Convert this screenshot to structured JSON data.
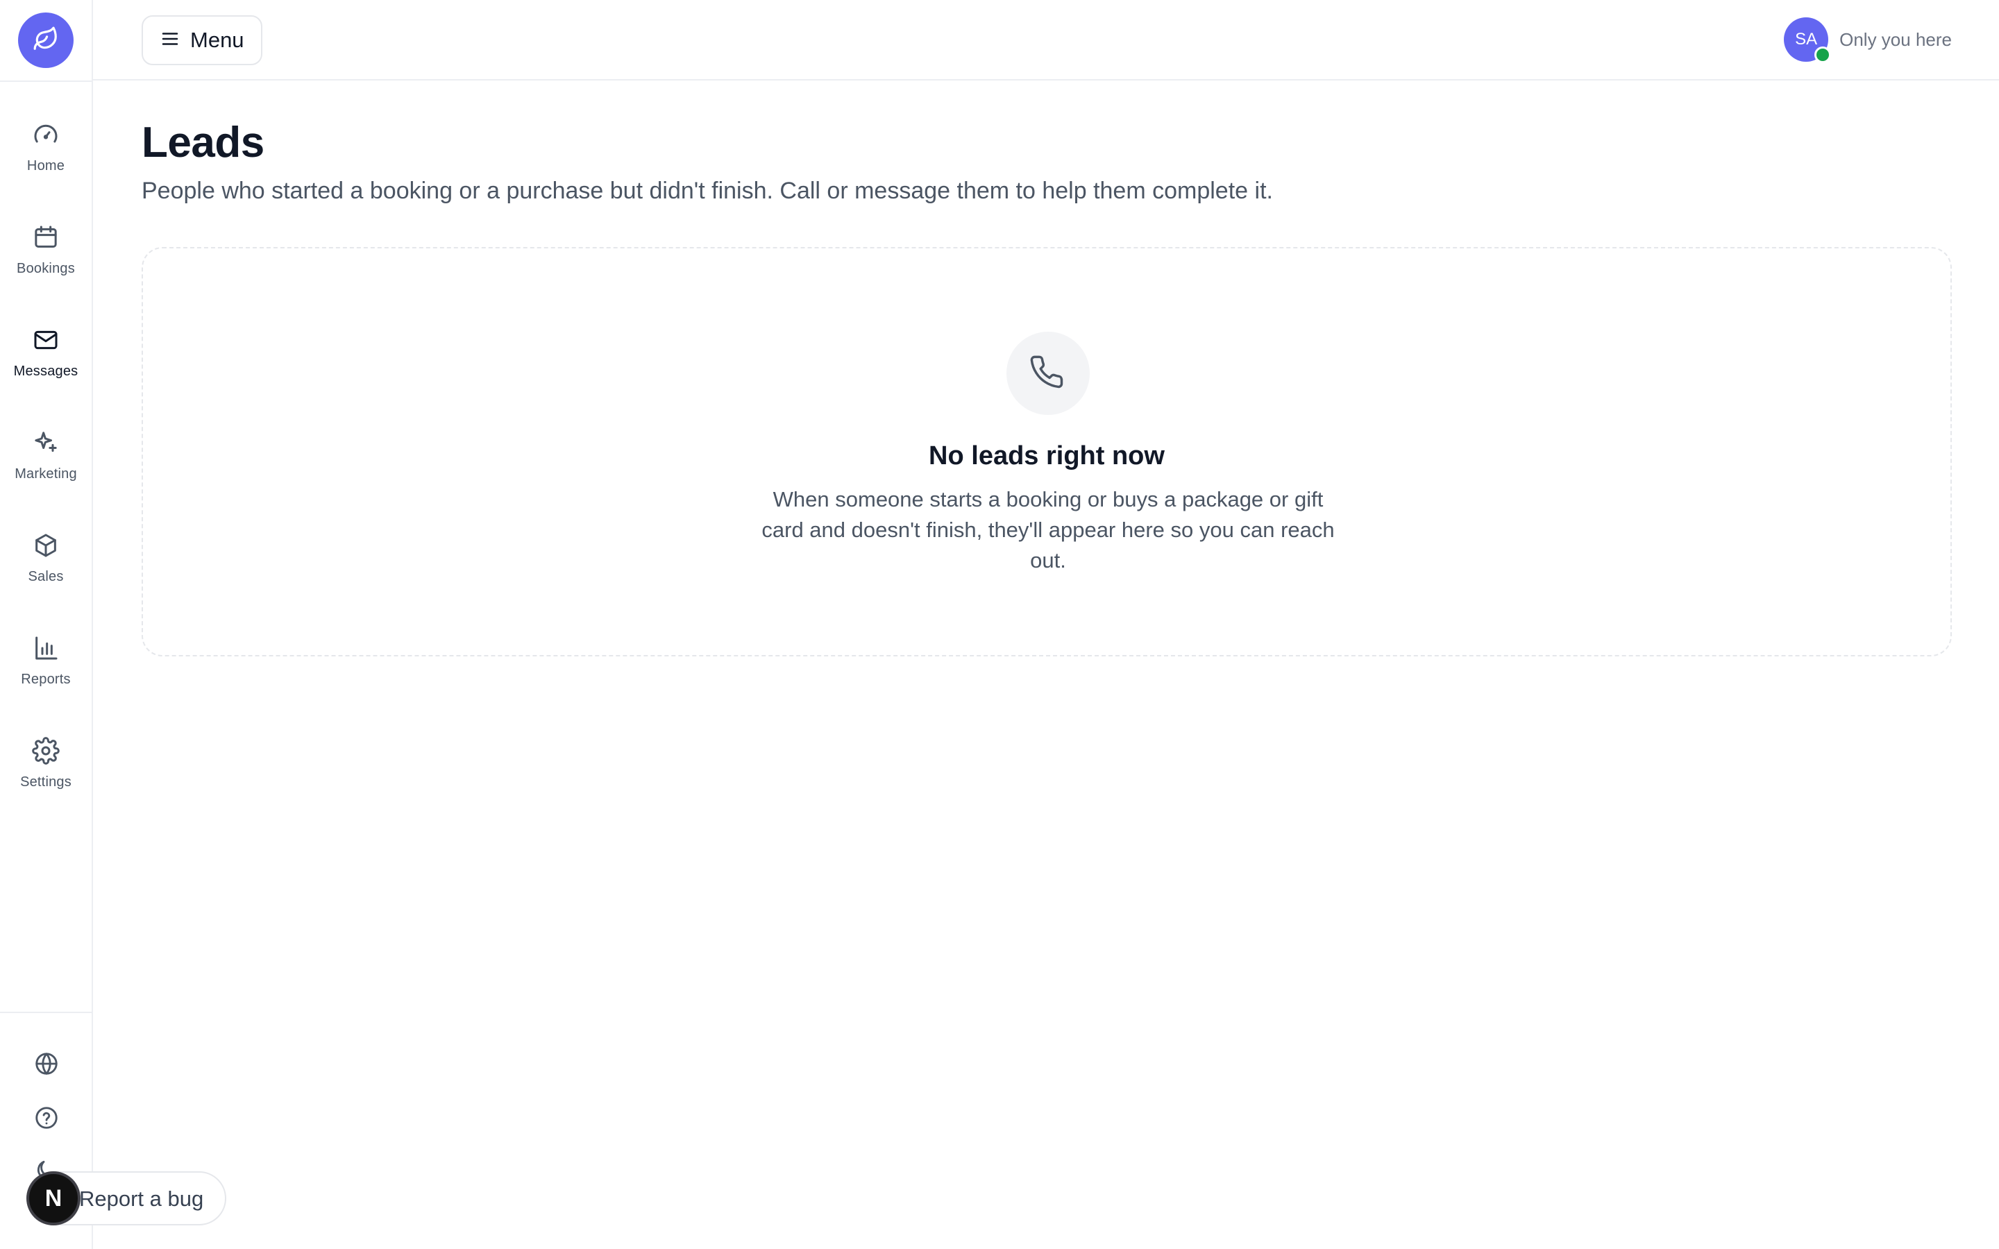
{
  "sidebar": {
    "logo_icon": "leaf-icon",
    "items": [
      {
        "label": "Home",
        "icon": "gauge-icon"
      },
      {
        "label": "Bookings",
        "icon": "calendar-icon"
      },
      {
        "label": "Messages",
        "icon": "mail-icon",
        "active": true
      },
      {
        "label": "Marketing",
        "icon": "sparkles-icon"
      },
      {
        "label": "Sales",
        "icon": "box-icon"
      },
      {
        "label": "Reports",
        "icon": "bar-chart-icon"
      },
      {
        "label": "Settings",
        "icon": "gear-icon"
      }
    ],
    "bottom": [
      "globe-icon",
      "help-icon",
      "moon-icon"
    ]
  },
  "header": {
    "menu_label": "Menu",
    "user_initials": "SA",
    "user_status_text": "Only you here",
    "presence_color": "#16a34a"
  },
  "main": {
    "title": "Leads",
    "description": "People who started a booking or a purchase but didn't finish. Call or message them to help them complete it.",
    "empty_state": {
      "icon": "phone-icon",
      "title": "No leads right now",
      "text": "When someone starts a booking or buys a package or gift card and doesn't finish, they'll appear here so you can reach out."
    }
  },
  "report_bug": {
    "badge": "N",
    "label": "Report a bug"
  },
  "colors": {
    "accent": "#6366f1",
    "text_primary": "#111827",
    "text_secondary": "#4b5563",
    "border": "#e5e7eb"
  }
}
